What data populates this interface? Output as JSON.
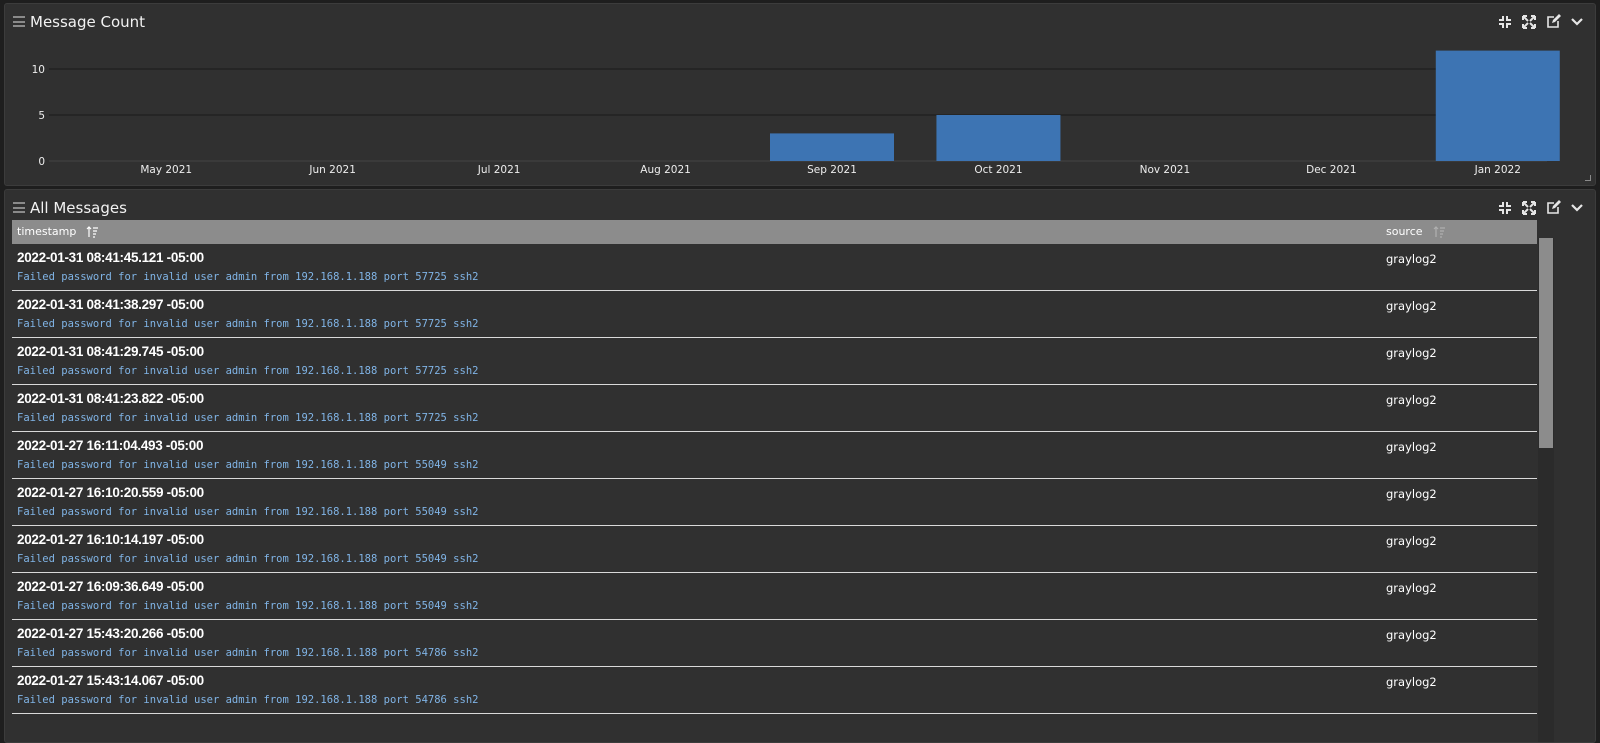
{
  "widgets": {
    "chart": {
      "title": "Message Count"
    },
    "table": {
      "title": "All Messages"
    }
  },
  "actions": [
    {
      "name": "focus-icon",
      "label": "Focus"
    },
    {
      "name": "expand-icon",
      "label": "Expand"
    },
    {
      "name": "edit-icon",
      "label": "Edit"
    },
    {
      "name": "chevron-down-icon",
      "label": "More"
    }
  ],
  "chart_data": {
    "type": "bar",
    "categories": [
      "May 2021",
      "Jun 2021",
      "Jul 2021",
      "Aug 2021",
      "Sep 2021",
      "Oct 2021",
      "Nov 2021",
      "Dec 2021",
      "Jan 2022"
    ],
    "values": [
      0,
      0,
      0,
      0,
      3,
      5,
      0,
      0,
      12
    ],
    "yticks": [
      0,
      5,
      10
    ],
    "ylim": [
      0,
      12
    ],
    "title": "",
    "xlabel": "",
    "ylabel": "",
    "bar_color": "#3d74b3",
    "grid": true
  },
  "table": {
    "columns": {
      "timestamp": "timestamp",
      "source": "source"
    },
    "rows": [
      {
        "timestamp": "2022-01-31 08:41:45.121 -05:00",
        "message": "Failed password for invalid user admin from 192.168.1.188 port 57725 ssh2",
        "source": "graylog2"
      },
      {
        "timestamp": "2022-01-31 08:41:38.297 -05:00",
        "message": "Failed password for invalid user admin from 192.168.1.188 port 57725 ssh2",
        "source": "graylog2"
      },
      {
        "timestamp": "2022-01-31 08:41:29.745 -05:00",
        "message": "Failed password for invalid user admin from 192.168.1.188 port 57725 ssh2",
        "source": "graylog2"
      },
      {
        "timestamp": "2022-01-31 08:41:23.822 -05:00",
        "message": "Failed password for invalid user admin from 192.168.1.188 port 57725 ssh2",
        "source": "graylog2"
      },
      {
        "timestamp": "2022-01-27 16:11:04.493 -05:00",
        "message": "Failed password for invalid user admin from 192.168.1.188 port 55049 ssh2",
        "source": "graylog2"
      },
      {
        "timestamp": "2022-01-27 16:10:20.559 -05:00",
        "message": "Failed password for invalid user admin from 192.168.1.188 port 55049 ssh2",
        "source": "graylog2"
      },
      {
        "timestamp": "2022-01-27 16:10:14.197 -05:00",
        "message": "Failed password for invalid user admin from 192.168.1.188 port 55049 ssh2",
        "source": "graylog2"
      },
      {
        "timestamp": "2022-01-27 16:09:36.649 -05:00",
        "message": "Failed password for invalid user admin from 192.168.1.188 port 55049 ssh2",
        "source": "graylog2"
      },
      {
        "timestamp": "2022-01-27 15:43:20.266 -05:00",
        "message": "Failed password for invalid user admin from 192.168.1.188 port 54786 ssh2",
        "source": "graylog2"
      },
      {
        "timestamp": "2022-01-27 15:43:14.067 -05:00",
        "message": "Failed password for invalid user admin from 192.168.1.188 port 54786 ssh2",
        "source": "graylog2"
      }
    ]
  }
}
